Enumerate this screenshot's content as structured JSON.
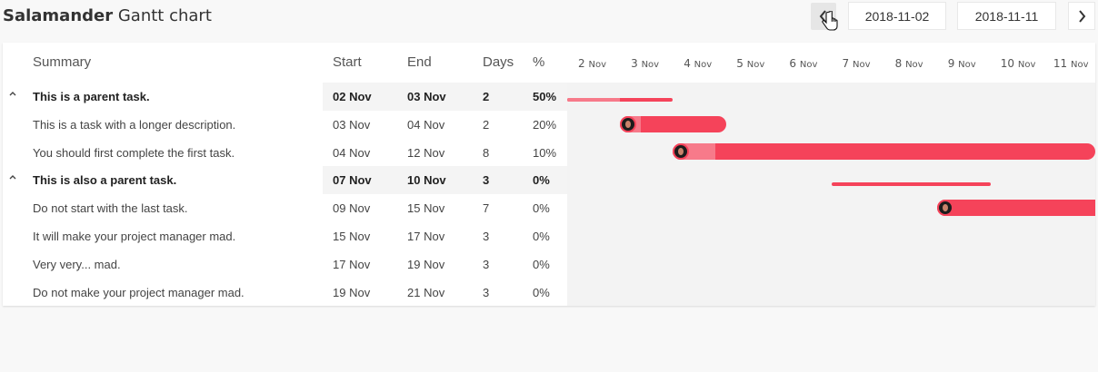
{
  "app": {
    "title_bold": "Salamander",
    "title_rest": "Gantt chart"
  },
  "toolbar": {
    "prev_icon": "chevron-left-icon",
    "next_icon": "chevron-right-icon",
    "start_date": "2018-11-02",
    "end_date": "2018-11-11"
  },
  "table": {
    "headers": {
      "summary": "Summary",
      "start": "Start",
      "end": "End",
      "days": "Days",
      "percent": "%"
    },
    "rows": [
      {
        "summary": "This is a parent task.",
        "start": "02 Nov",
        "end": "03 Nov",
        "days": "2",
        "percent": "50%",
        "parent": true
      },
      {
        "summary": "This is a task with a longer description.",
        "start": "03 Nov",
        "end": "04 Nov",
        "days": "2",
        "percent": "20%",
        "parent": false
      },
      {
        "summary": "You should first complete the first task.",
        "start": "04 Nov",
        "end": "12 Nov",
        "days": "8",
        "percent": "10%",
        "parent": false
      },
      {
        "summary": "This is also a parent task.",
        "start": "07 Nov",
        "end": "10 Nov",
        "days": "3",
        "percent": "0%",
        "parent": true
      },
      {
        "summary": "Do not start with the last task.",
        "start": "09 Nov",
        "end": "15 Nov",
        "days": "7",
        "percent": "0%",
        "parent": false
      },
      {
        "summary": "It will make your project manager mad.",
        "start": "15 Nov",
        "end": "17 Nov",
        "days": "3",
        "percent": "0%",
        "parent": false
      },
      {
        "summary": "Very very... mad.",
        "start": "17 Nov",
        "end": "19 Nov",
        "days": "3",
        "percent": "0%",
        "parent": false
      },
      {
        "summary": "Do not make your project manager mad.",
        "start": "19 Nov",
        "end": "21 Nov",
        "days": "3",
        "percent": "0%",
        "parent": false
      }
    ]
  },
  "timeline": {
    "days": [
      {
        "num": "2",
        "mon": "Nov"
      },
      {
        "num": "3",
        "mon": "Nov"
      },
      {
        "num": "4",
        "mon": "Nov"
      },
      {
        "num": "5",
        "mon": "Nov"
      },
      {
        "num": "6",
        "mon": "Nov"
      },
      {
        "num": "7",
        "mon": "Nov"
      },
      {
        "num": "8",
        "mon": "Nov"
      },
      {
        "num": "9",
        "mon": "Nov"
      },
      {
        "num": "10",
        "mon": "Nov"
      },
      {
        "num": "11",
        "mon": "Nov"
      }
    ]
  },
  "colors": {
    "bar": "#f5435a",
    "bar_progress": "#f77a8a",
    "chart_bg": "#f3f3f3"
  }
}
